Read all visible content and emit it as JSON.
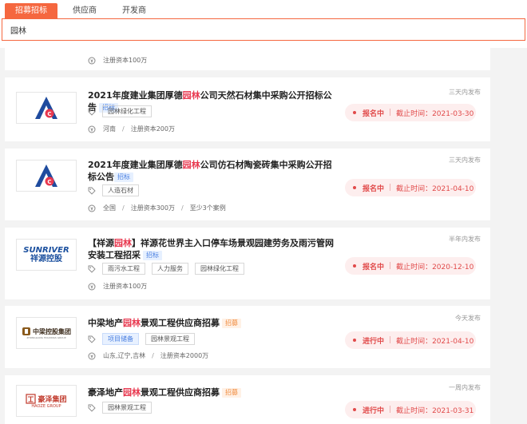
{
  "tabs": [
    {
      "label": "招募招标",
      "active": true
    },
    {
      "label": "供应商",
      "active": false
    },
    {
      "label": "开发商",
      "active": false
    }
  ],
  "search": {
    "value": "园林"
  },
  "partial_card": {
    "meta": "注册资本100万"
  },
  "cards": [
    {
      "title_pre": "2021年度建业集团厚德",
      "title_hl": "园林",
      "title_post": "公司天然石材集中采购公开招标公告",
      "badge": "招标",
      "tags": [
        "园林绿化工程"
      ],
      "meta": [
        "河南",
        "注册资本200万"
      ],
      "time": "三天内发布",
      "status": "报名中",
      "deadline": "截止时间：2021-03-30"
    },
    {
      "title_pre": "2021年度建业集团厚德",
      "title_hl": "园林",
      "title_post": "公司仿石材陶瓷砖集中采购公开招标公告",
      "badge": "招标",
      "tags": [
        "人造石材"
      ],
      "meta": [
        "全国",
        "注册资本300万",
        "至少3个案例"
      ],
      "time": "三天内发布",
      "status": "报名中",
      "deadline": "截止时间：2021-04-10"
    },
    {
      "title_pre": "【祥源",
      "title_hl": "园林",
      "title_post": "】祥源花世界主入口停车场景观园建劳务及雨污管网安装工程招采",
      "badge": "招标",
      "tags": [
        "雨污水工程",
        "人力服务",
        "园林绿化工程"
      ],
      "meta": [
        "注册资本100万"
      ],
      "time": "半年内发布",
      "status": "报名中",
      "deadline": "截止时间：2020-12-10",
      "logo_line1": "SUNRIVER",
      "logo_line2": "祥源控股"
    },
    {
      "title_pre": "中梁地产",
      "title_hl": "园林",
      "title_post": "景观工程供应商招募",
      "badge": "招募",
      "tags": [
        "项目储备",
        "园林景观工程"
      ],
      "meta": [
        "山东,辽宁,吉林",
        "注册资本2000万"
      ],
      "time": "今天发布",
      "status": "进行中",
      "deadline": "截止时间：2021-04-10",
      "logo_line1": "中梁控股集团",
      "logo_line2": "ZHONGLIANG HOLDINGS GROUP"
    },
    {
      "title_pre": "豪泽地产",
      "title_hl": "园林",
      "title_post": "景观工程供应商招募",
      "badge": "招募",
      "tags": [
        "园林景观工程"
      ],
      "meta": [],
      "time": "一周内发布",
      "status": "进行中",
      "deadline": "截止时间：2021-03-31",
      "logo_line1": "豪泽集团",
      "logo_line2": "HAOZE GROUP"
    }
  ],
  "colors": {
    "accent": "#f5673f",
    "highlight": "#e8384f",
    "status_red": "#e14a4a"
  }
}
